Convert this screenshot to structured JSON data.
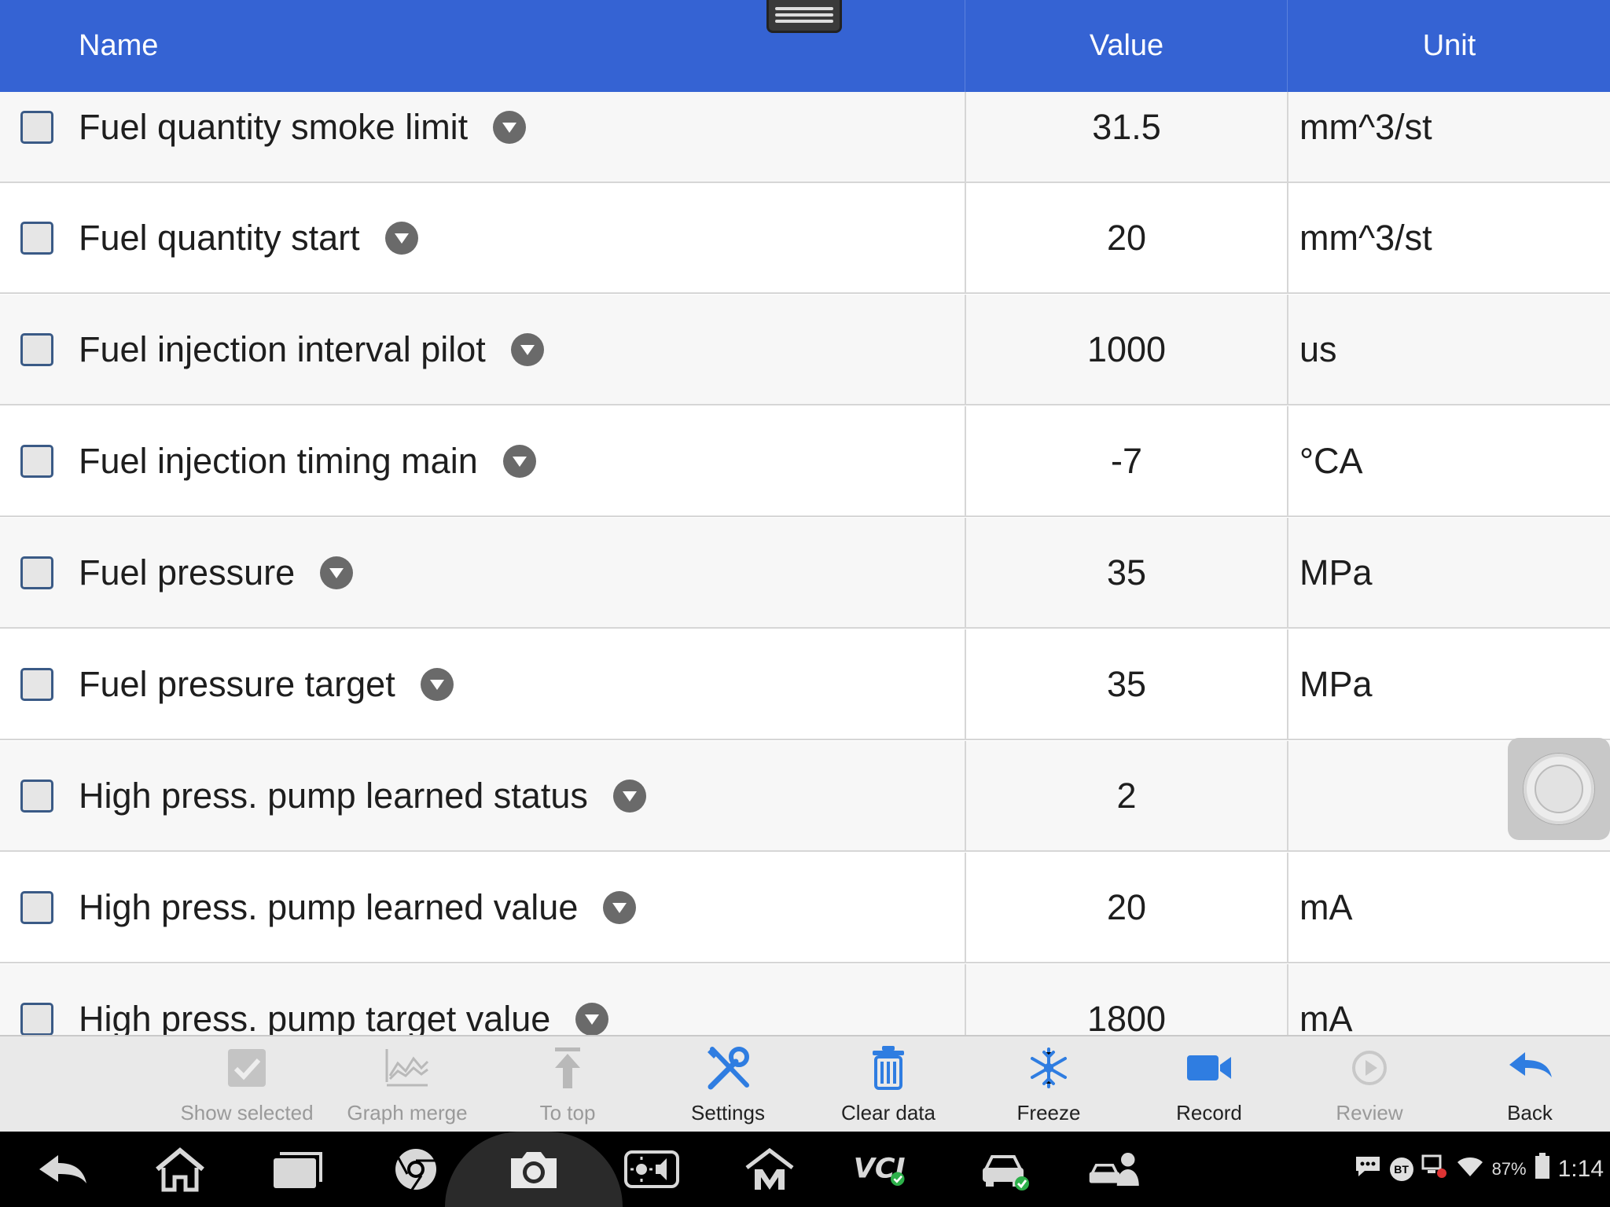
{
  "header": {
    "name_label": "Name",
    "value_label": "Value",
    "unit_label": "Unit"
  },
  "rows": [
    {
      "name": "Fuel quantity smoke limit",
      "value": "31.5",
      "unit": "mm^3/st"
    },
    {
      "name": "Fuel quantity start",
      "value": "20",
      "unit": "mm^3/st"
    },
    {
      "name": "Fuel injection interval pilot",
      "value": "1000",
      "unit": "us"
    },
    {
      "name": "Fuel injection timing main",
      "value": "-7",
      "unit": "°CA"
    },
    {
      "name": "Fuel pressure",
      "value": "35",
      "unit": "MPa"
    },
    {
      "name": "Fuel pressure target",
      "value": "35",
      "unit": "MPa"
    },
    {
      "name": "High press. pump learned status",
      "value": "2",
      "unit": ""
    },
    {
      "name": "High press. pump learned value",
      "value": "20",
      "unit": "mA"
    },
    {
      "name": "High press. pump target value",
      "value": "1800",
      "unit": "mA"
    }
  ],
  "toolbar": {
    "show_selected": "Show selected",
    "graph_merge": "Graph merge",
    "to_top": "To top",
    "settings": "Settings",
    "clear_data": "Clear data",
    "freeze": "Freeze",
    "record": "Record",
    "review": "Review",
    "back": "Back"
  },
  "status_bar": {
    "bt": "BT",
    "battery": "87%",
    "time": "1:14"
  },
  "colors": {
    "header_bg": "#3563d3",
    "accent_icon": "#2f7de1"
  }
}
